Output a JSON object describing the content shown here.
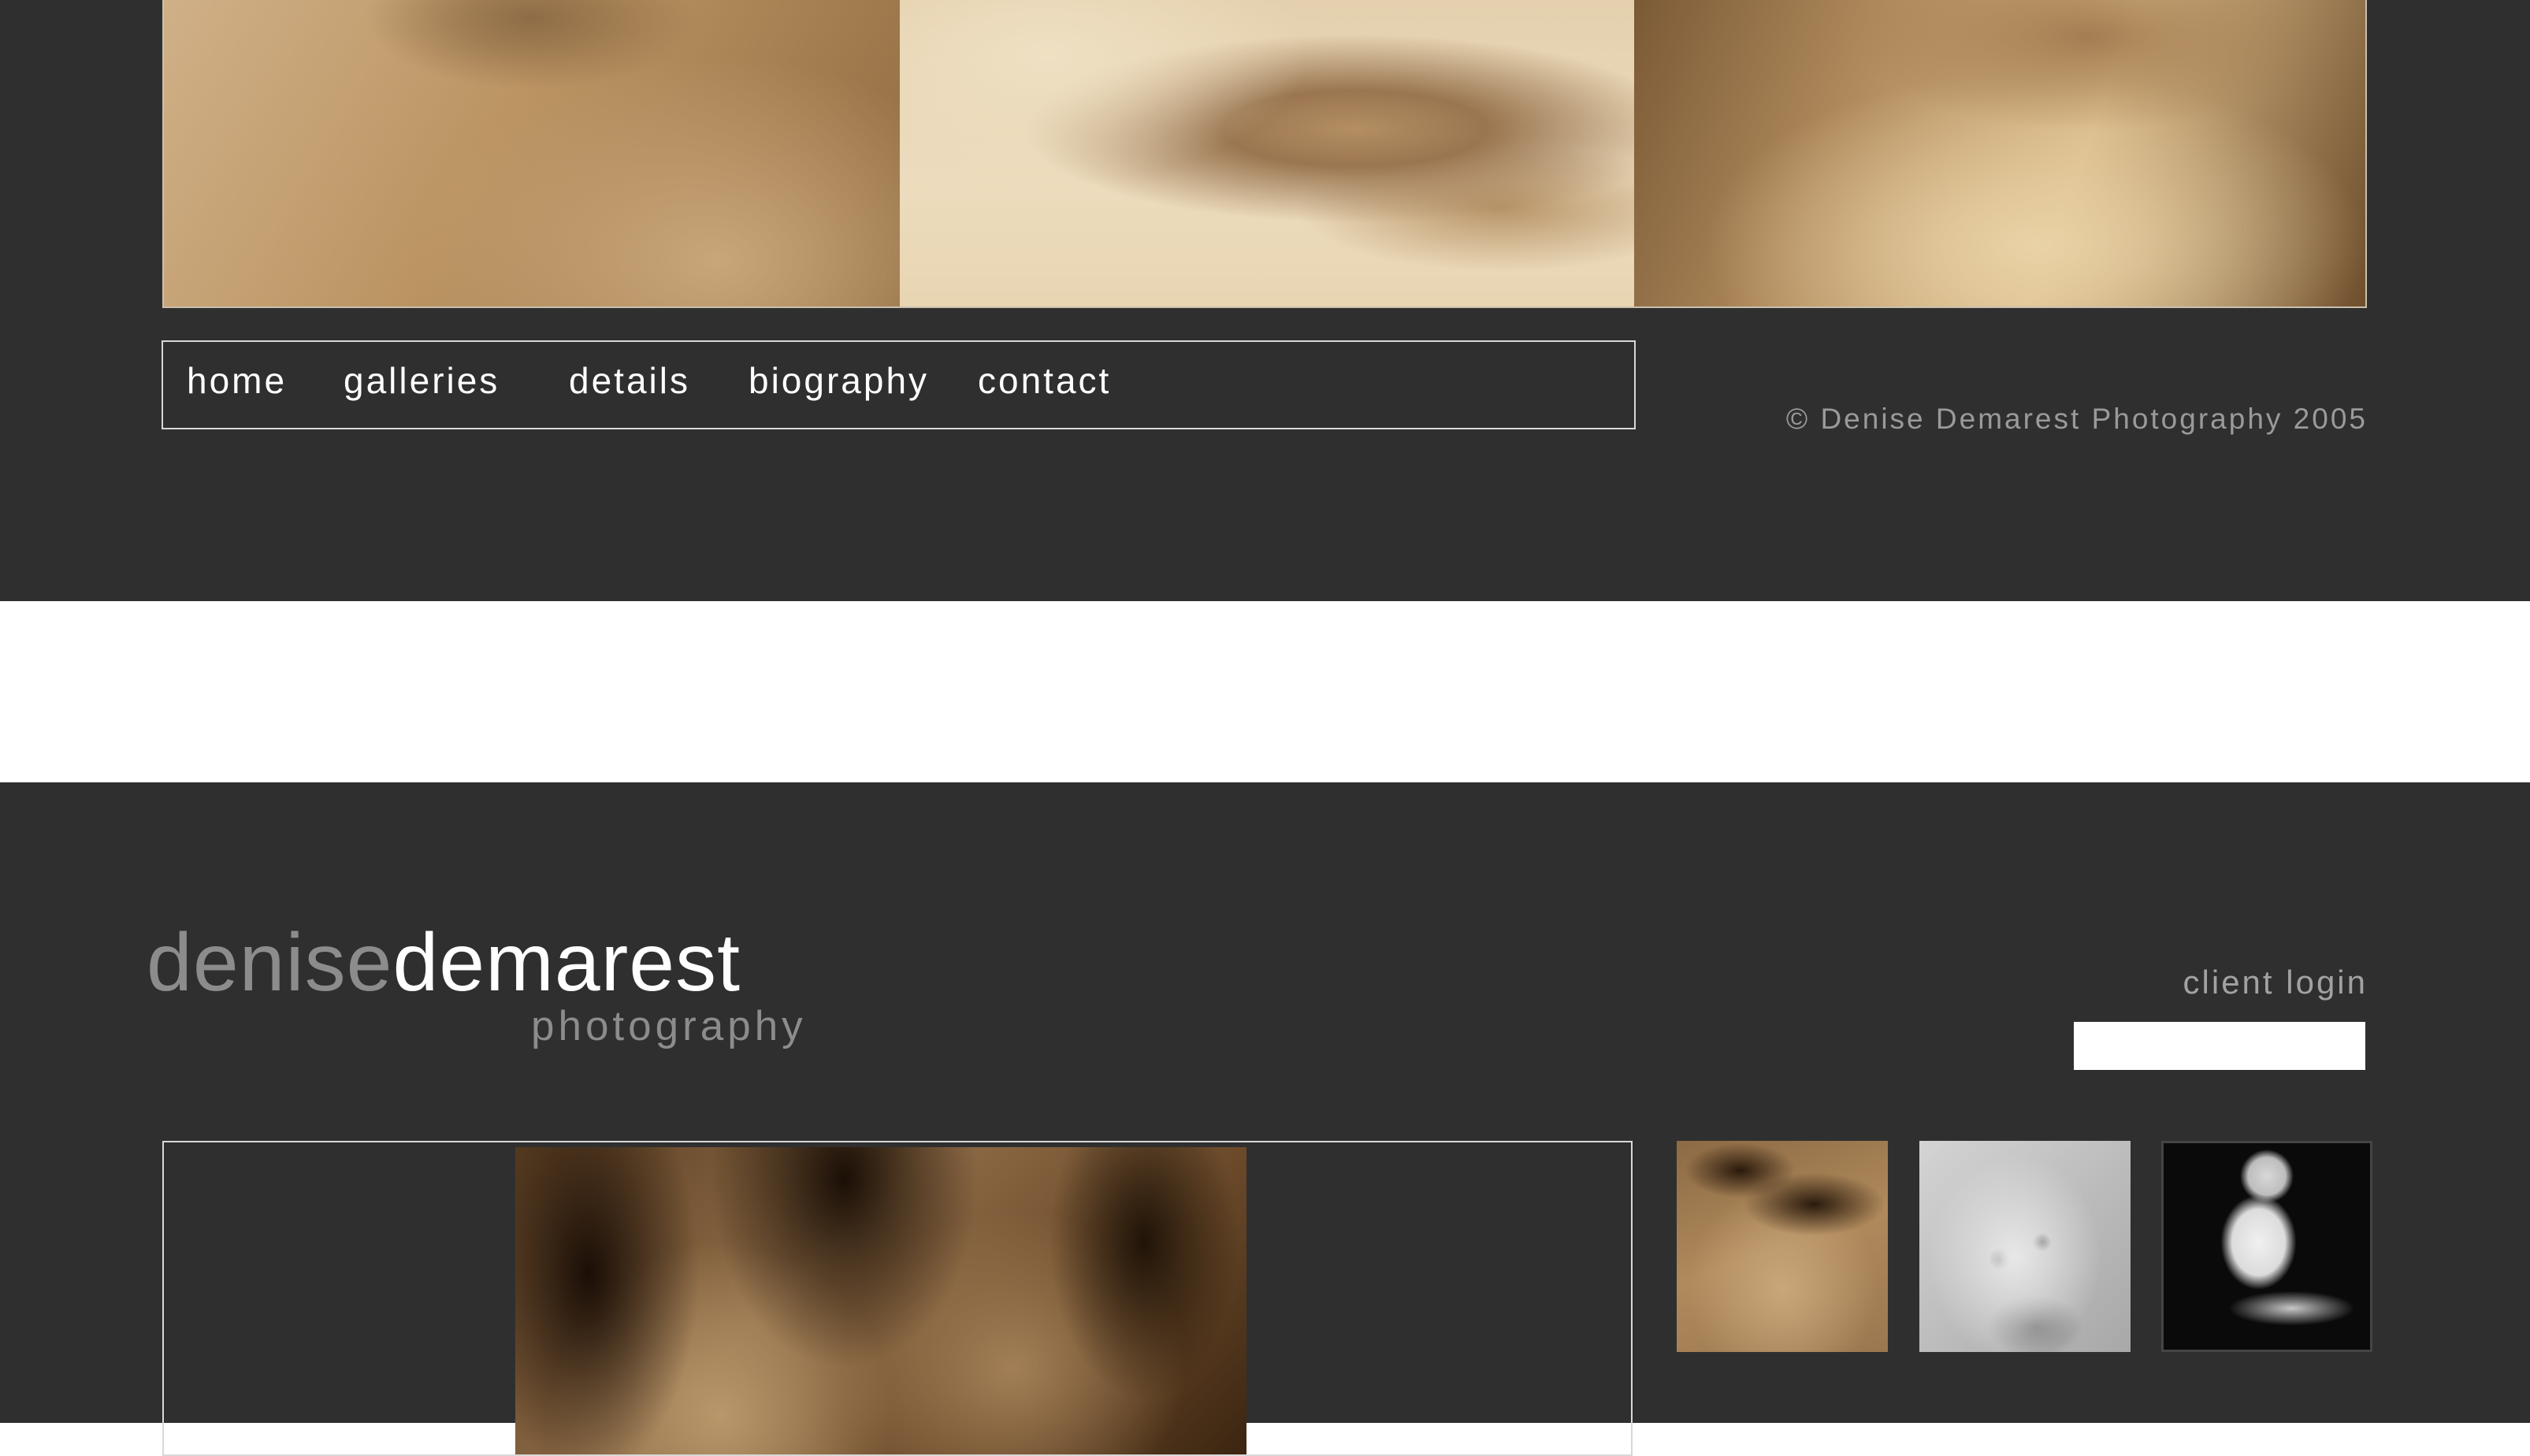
{
  "nav": {
    "items": [
      {
        "label": "home"
      },
      {
        "label": "galleries"
      },
      {
        "label": "details"
      },
      {
        "label": "biography"
      },
      {
        "label": "contact"
      }
    ]
  },
  "footer": {
    "copyright": "© Denise Demarest Photography 2005"
  },
  "logo": {
    "first": "denise",
    "last": "demarest",
    "sub": "photography"
  },
  "login": {
    "label": "client login",
    "value": ""
  },
  "colors": {
    "background": "#2f2f2f",
    "gap": "#ffffff",
    "logo_first": "#8c8c8c",
    "logo_last": "#ffffff",
    "sepia": "#b08a5c"
  }
}
